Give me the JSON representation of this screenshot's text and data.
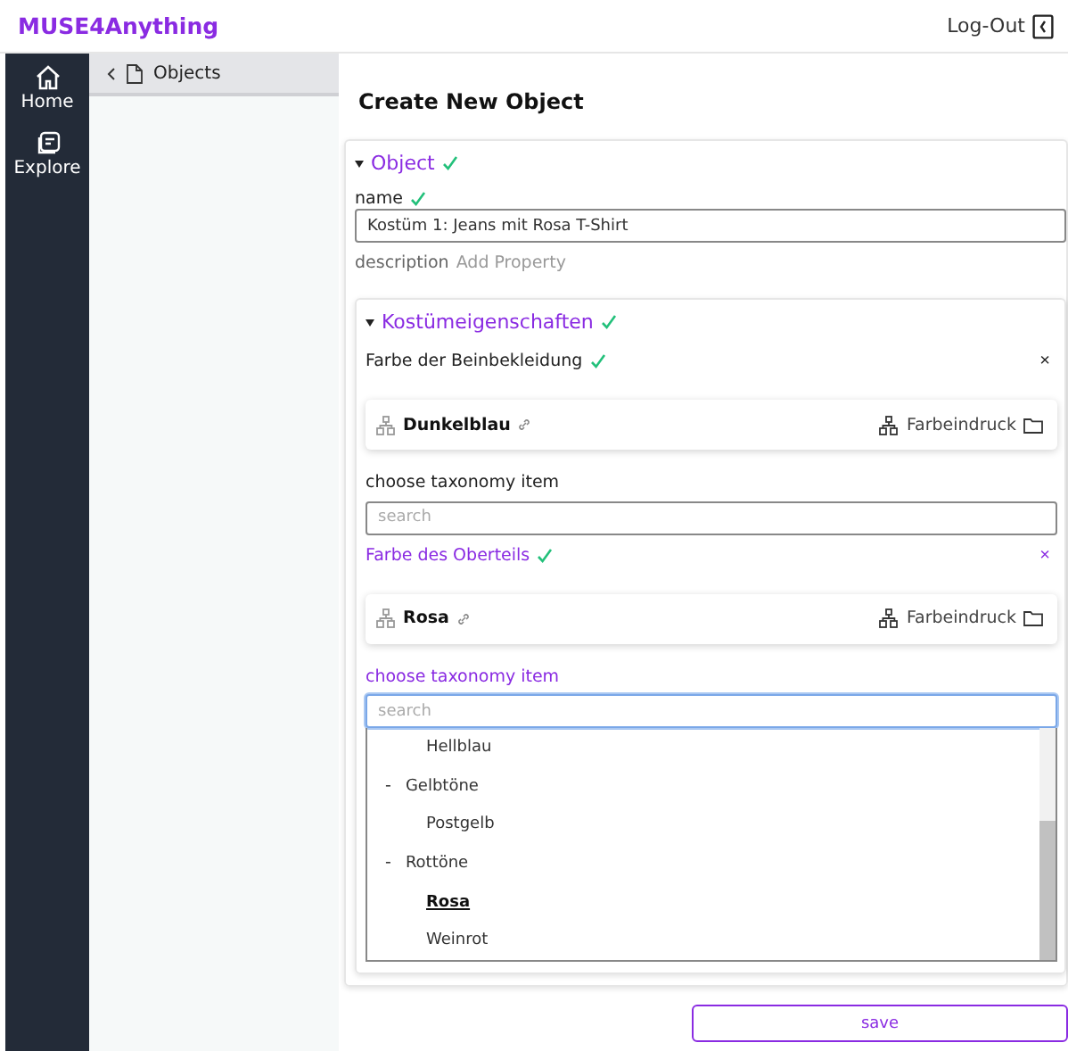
{
  "app": {
    "title": "MUSE4Anything",
    "logout": "Log-Out"
  },
  "nav": [
    {
      "label": "Home",
      "selected": false
    },
    {
      "label": "Explore",
      "selected": false
    }
  ],
  "breadcrumb": {
    "label": "Objects"
  },
  "page_title": "Create New Object",
  "object": {
    "title": "Object",
    "valid": true,
    "expanded": true,
    "name": {
      "label": "name",
      "valid": true,
      "value": "Kostüm 1: Jeans mit Rosa T-Shirt"
    },
    "description": {
      "label": "description",
      "action": "Add Property"
    },
    "group": {
      "title": "Kostümeigenschaften",
      "valid": true,
      "expanded": true,
      "properties": [
        {
          "label": "Farbe der Beinbekleidung",
          "valid": true,
          "focused": false,
          "remove": "×",
          "item": "Dunkelblau",
          "taxonomy": "Farbeindruck",
          "choose_label": "choose taxonomy item",
          "search": {
            "placeholder": "search"
          }
        },
        {
          "label": "Farbe des Oberteils",
          "valid": true,
          "focused": true,
          "remove": "×",
          "item": "Rosa",
          "taxonomy": "Farbeindruck",
          "choose_label": "choose taxonomy item",
          "search": {
            "placeholder": "search"
          },
          "options": [
            {
              "kind": "leaf",
              "label": "Hellblau",
              "selected": false
            },
            {
              "kind": "group",
              "label": "Gelbtöne",
              "bullet": "-",
              "children": [
                {
                  "label": "Postgelb",
                  "selected": false
                }
              ]
            },
            {
              "kind": "group",
              "label": "Rottöne",
              "bullet": "-",
              "children": [
                {
                  "label": "Rosa",
                  "selected": true
                },
                {
                  "label": "Weinrot",
                  "selected": false
                }
              ]
            }
          ]
        }
      ]
    }
  },
  "save": "save"
}
